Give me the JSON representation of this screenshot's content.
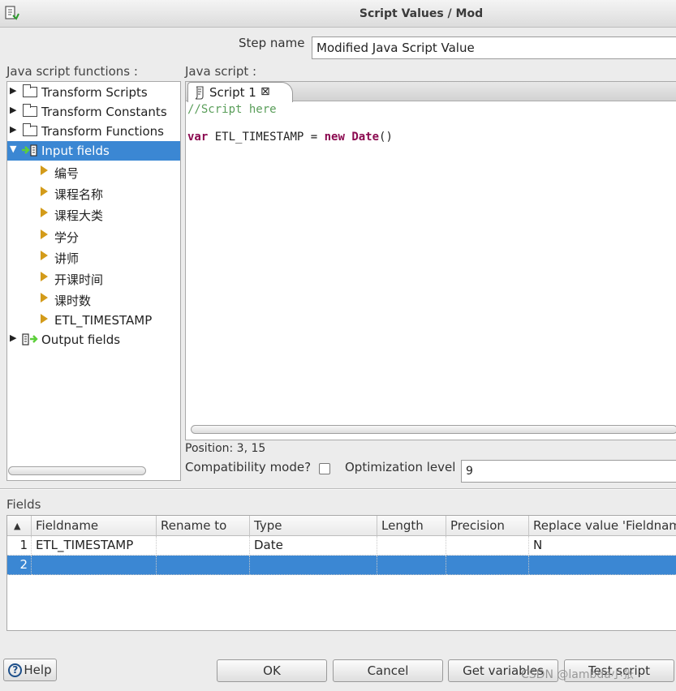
{
  "window": {
    "title": "Script Values / Mod"
  },
  "step": {
    "label": "Step name",
    "value": "Modified Java Script Value"
  },
  "functions_panel": {
    "label": "Java script functions :",
    "top_items": [
      {
        "label": "Transform Scripts"
      },
      {
        "label": "Transform Constants"
      },
      {
        "label": "Transform Functions"
      }
    ],
    "input_fields": {
      "label": "Input fields",
      "children": [
        "编号",
        "课程名称",
        "课程大类",
        "学分",
        "讲师",
        "开课时间",
        "课时数",
        "ETL_TIMESTAMP"
      ]
    },
    "output_fields": {
      "label": "Output fields"
    }
  },
  "editor": {
    "label": "Java script :",
    "tab_label": "Script 1",
    "tab_close": "⊠",
    "comment": "//Script here",
    "code_kw_var": "var",
    "code_middle": " ETL_TIMESTAMP = ",
    "code_kw_new": "new",
    "code_kw_date": "Date",
    "code_end": "()"
  },
  "status": {
    "position": "Position: 3, 15",
    "compat_label": "Compatibility mode?",
    "compat_checked": false,
    "optim_label": "Optimization level",
    "optim_value": "9"
  },
  "fields": {
    "label": "Fields",
    "sort_indicator": "▲",
    "columns": [
      "Fieldname",
      "Rename to",
      "Type",
      "Length",
      "Precision",
      "Replace value 'Fieldname' or 'Rename to'"
    ],
    "rows": [
      {
        "num": "1",
        "fieldname": "ETL_TIMESTAMP",
        "rename": "",
        "type": "Date",
        "length": "",
        "precision": "",
        "replace": "N"
      },
      {
        "num": "2",
        "fieldname": "",
        "rename": "",
        "type": "",
        "length": "",
        "precision": "",
        "replace": ""
      }
    ]
  },
  "buttons": {
    "help": "Help",
    "help_icon": "?",
    "ok": "OK",
    "cancel": "Cancel",
    "get_variables": "Get variables",
    "test_script": "Test script"
  },
  "watermark": "CSDN @lambda小张",
  "colors": {
    "selection": "#3b87d3",
    "comment": "#5a9e5a",
    "keyword": "#8b0a50",
    "folder_arrow": "#d39b1a"
  }
}
